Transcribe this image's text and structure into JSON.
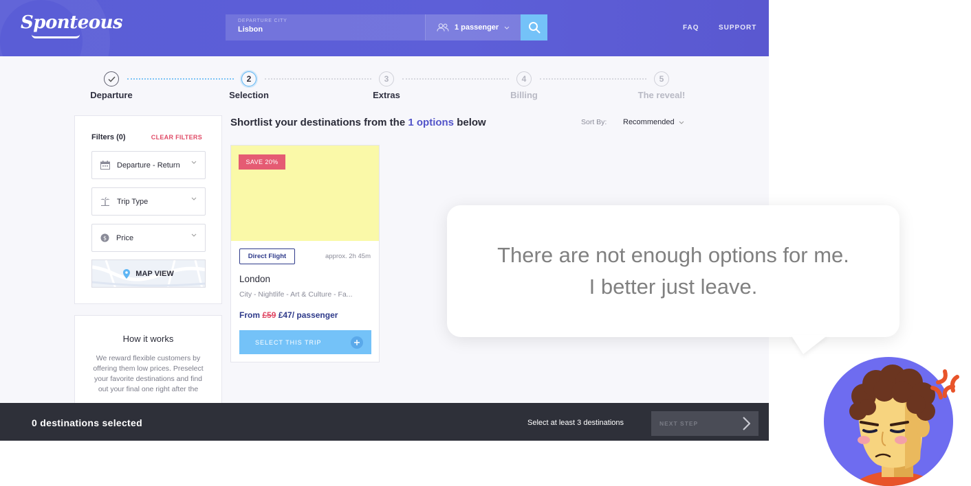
{
  "header": {
    "logo": "Sponteous",
    "departure_label": "DEPARTURE CITY",
    "departure_value": "Lisbon",
    "passengers": "1 passenger",
    "faq": "FAQ",
    "support": "SUPPORT"
  },
  "steps": [
    {
      "num": "",
      "label": "Departure",
      "state": "done"
    },
    {
      "num": "2",
      "label": "Selection",
      "state": "active"
    },
    {
      "num": "3",
      "label": "Extras",
      "state": "upcoming"
    },
    {
      "num": "4",
      "label": "Billing",
      "state": "upcoming"
    },
    {
      "num": "5",
      "label": "The reveal!",
      "state": "upcoming"
    }
  ],
  "filters": {
    "title": "Filters (0)",
    "clear": "CLEAR FILTERS",
    "dates": "Departure - Return",
    "trip_type": "Trip Type",
    "price": "Price",
    "map_view": "MAP VIEW"
  },
  "how_it_works": {
    "title": "How it works",
    "text": "We reward flexible customers by offering them low prices. Preselect your favorite destinations and find out your final one right after the"
  },
  "main": {
    "headline_pre": "Shortlist your destinations from the ",
    "headline_count": "1 options",
    "headline_post": " below",
    "sort_label": "Sort By:",
    "sort_value": "Recommended"
  },
  "card": {
    "badge": "SAVE 20%",
    "flight_type": "Direct Flight",
    "duration": "approx. 2h 45m",
    "city": "London",
    "tags": "City - Nightlife - Art & Culture - Fa...",
    "price_from": "From ",
    "price_old": "£59",
    "price_new": " £47/ passenger",
    "select": "SELECT THIS TRIP"
  },
  "footer": {
    "selected": "0 destinations selected",
    "hint": "Select at least 3 destinations",
    "next": "NEXT STEP"
  },
  "bubble": {
    "line1": "There are not enough options for me.",
    "line2": "I better just leave."
  },
  "colors": {
    "header": "#5a5dd6",
    "accent_blue": "#74c2f8",
    "brand_navy": "#2e3a8a",
    "sale_red": "#e55b73",
    "footer_bg": "#2e3039",
    "card_image": "#faf9a8"
  }
}
